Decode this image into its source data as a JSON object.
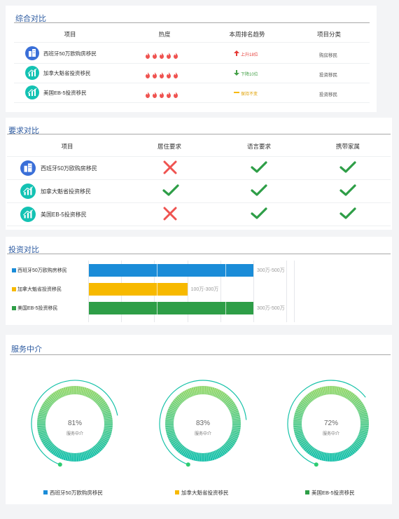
{
  "colors": {
    "blue": "#1a8cd8",
    "yellow": "#f7b900",
    "green": "#2e9e47",
    "teal": "#13c2b3",
    "title": "#2c5aa0",
    "flame": "#ef5350",
    "check": "#2e9e47",
    "cross": "#ef5350"
  },
  "comprehensive": {
    "title": "综合对比",
    "headers": [
      "项目",
      "热度",
      "本周排名趋势",
      "项目分类"
    ],
    "rows": [
      {
        "name": "西班牙50万欧购房移民",
        "icon": "building-icon",
        "heat": 5,
        "trend_dir": "up",
        "trend": "上升18位",
        "category": "购房移民"
      },
      {
        "name": "加拿大魁省投资移民",
        "icon": "chart-icon",
        "heat": 5,
        "trend_dir": "down",
        "trend": "下降10位",
        "category": "投资移民"
      },
      {
        "name": "美国EB-5投资移民",
        "icon": "chart-icon",
        "heat": 5,
        "trend_dir": "flat",
        "trend": "保持不变",
        "category": "投资移民"
      }
    ]
  },
  "requirements": {
    "title": "要求对比",
    "headers": [
      "项目",
      "居住要求",
      "语言要求",
      "携带家属"
    ],
    "rows": [
      {
        "name": "西班牙50万欧购房移民",
        "icon": "building-icon",
        "residence": false,
        "language": true,
        "family": true
      },
      {
        "name": "加拿大魁省投资移民",
        "icon": "chart-icon",
        "residence": true,
        "language": true,
        "family": true
      },
      {
        "name": "美国EB-5投资移民",
        "icon": "chart-icon",
        "residence": false,
        "language": true,
        "family": true
      }
    ]
  },
  "investment": {
    "title": "投资对比",
    "items": [
      {
        "name": "西班牙50万欧购房移民",
        "range": "300万-500万",
        "max": 500,
        "color": "#1a8cd8"
      },
      {
        "name": "加拿大魁省投资移民",
        "range": "100万-300万",
        "max": 300,
        "color": "#f7b900"
      },
      {
        "name": "美国EB-5投资移民",
        "range": "300万-500万",
        "max": 500,
        "color": "#2e9e47"
      }
    ]
  },
  "services": {
    "title": "服务中介",
    "gauges": [
      {
        "percent": 81,
        "label": "81%",
        "sub": "服务中介",
        "name": "西班牙50万欧购房移民",
        "color": "#1a8cd8"
      },
      {
        "percent": 83,
        "label": "83%",
        "sub": "服务中介",
        "name": "加拿大魁省投资移民",
        "color": "#f7b900"
      },
      {
        "percent": 72,
        "label": "72%",
        "sub": "服务中介",
        "name": "美国EB-5投资移民",
        "color": "#2e9e47"
      }
    ]
  }
}
